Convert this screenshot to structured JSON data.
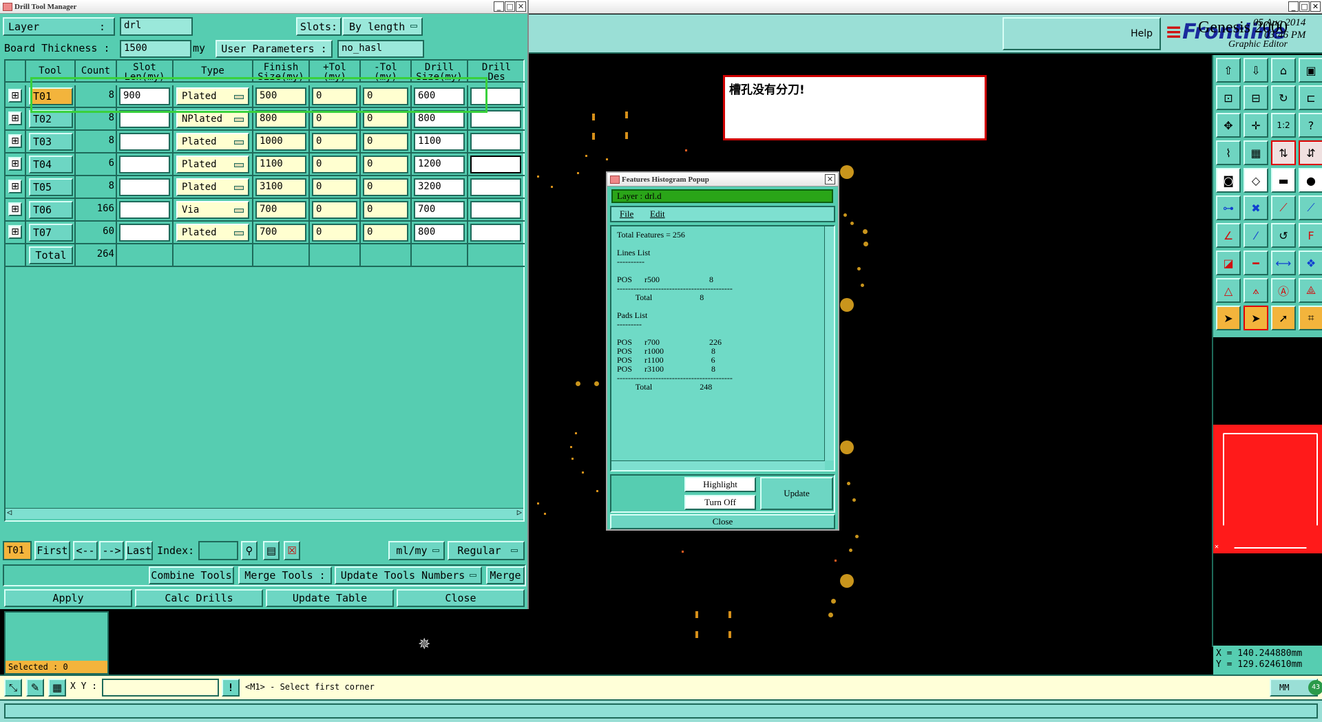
{
  "drill_manager": {
    "window_title": "Drill Tool Manager",
    "layer_label": "Layer",
    "layer_value": "drl",
    "slots_label": "Slots:",
    "slots_value": "By length",
    "thickness_label": "Board Thickness :",
    "thickness_value": "1500",
    "thickness_unit": "my",
    "user_params_label": "User Parameters :",
    "user_params_value": "no_hasl",
    "columns": [
      "Tool",
      "Count",
      "Slot\nLen(my)",
      "Type",
      "Finish\nSize(my)",
      "+Tol\n(my)",
      "-Tol\n(my)",
      "Drill\nSize(my)",
      "Drill\nDes"
    ],
    "rows": [
      {
        "tool": "T01",
        "count": "8",
        "slot": "900",
        "type": "Plated",
        "finish": "500",
        "ptol": "0",
        "mtol": "0",
        "drill": "600",
        "des": ""
      },
      {
        "tool": "T02",
        "count": "8",
        "slot": "",
        "type": "NPlated",
        "finish": "800",
        "ptol": "0",
        "mtol": "0",
        "drill": "800",
        "des": ""
      },
      {
        "tool": "T03",
        "count": "8",
        "slot": "",
        "type": "Plated",
        "finish": "1000",
        "ptol": "0",
        "mtol": "0",
        "drill": "1100",
        "des": ""
      },
      {
        "tool": "T04",
        "count": "6",
        "slot": "",
        "type": "Plated",
        "finish": "1100",
        "ptol": "0",
        "mtol": "0",
        "drill": "1200",
        "des": ""
      },
      {
        "tool": "T05",
        "count": "8",
        "slot": "",
        "type": "Plated",
        "finish": "3100",
        "ptol": "0",
        "mtol": "0",
        "drill": "3200",
        "des": ""
      },
      {
        "tool": "T06",
        "count": "166",
        "slot": "",
        "type": "Via",
        "finish": "700",
        "ptol": "0",
        "mtol": "0",
        "drill": "700",
        "des": ""
      },
      {
        "tool": "T07",
        "count": "60",
        "slot": "",
        "type": "Plated",
        "finish": "700",
        "ptol": "0",
        "mtol": "0",
        "drill": "800",
        "des": ""
      }
    ],
    "total_label": "Total",
    "total_count": "264",
    "current_tool": "T01",
    "nav": {
      "first": "First",
      "prev": "<--",
      "next": "-->",
      "last": "Last",
      "index_label": "Index:",
      "units": "ml/my",
      "mode": "Regular"
    },
    "actions": {
      "combine": "Combine Tools",
      "merge_label": "Merge Tools :",
      "update_numbers": "Update Tools Numbers",
      "merge": "Merge"
    },
    "bottom": {
      "apply": "Apply",
      "calc": "Calc Drills",
      "update_table": "Update Table",
      "close": "Close"
    }
  },
  "header": {
    "help": "Help",
    "brand": "Frontline",
    "product": "Genesis 2000",
    "subtitle": "Graphic Editor",
    "date": "05 Aug 2014",
    "time": "03:46 PM"
  },
  "annotation_note": "槽孔没有分刀!",
  "histogram": {
    "title": "Features Histogram Popup",
    "layer_text": "Layer :  drl.d",
    "menu_file": "File",
    "menu_edit": "Edit",
    "report": "Total Features = 256\n\nLines List\n----------\n\nPOS      r500                        8\n------------------------------------------\n         Total                       8\n\nPads List\n---------\n\nPOS      r700                        226\nPOS      r1000                       8\nPOS      r1100                       6\nPOS      r3100                       8\n------------------------------------------\n         Total                       248",
    "highlight": "Highlight",
    "turn_off": "Turn Off",
    "update": "Update",
    "close": "Close"
  },
  "status": {
    "selected": "Selected : 0",
    "xy_label": "X Y :",
    "prompt": "<M1> - Select first corner",
    "units": "MM",
    "coord_x": "X = 140.244880mm",
    "coord_y": "Y = 129.624610mm",
    "badge": "43"
  },
  "colors": {
    "panel": "#56cdb1",
    "accent": "#f3b43c",
    "highlight_box": "#39d13c",
    "note_border": "#d00000",
    "preview": "#ff1a1a"
  }
}
